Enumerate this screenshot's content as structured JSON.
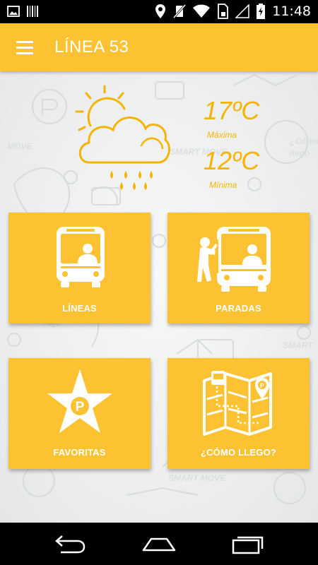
{
  "status_bar": {
    "time": "11:48",
    "icons": [
      "image-icon",
      "barcode-icon",
      "location-icon",
      "vibrate-icon",
      "wifi-icon",
      "sim-icon",
      "signal-icon",
      "battery-icon"
    ]
  },
  "app_bar": {
    "title": "LÍNEA 53",
    "menu_icon": "hamburger-menu-icon",
    "color": "#fcc232"
  },
  "weather": {
    "icon": "partly-cloudy-rain-icon",
    "max_temp": "17ºC",
    "max_label": "Máxima",
    "min_temp": "12ºC",
    "min_label": "Mínima",
    "color": "#f5b400"
  },
  "tiles": [
    {
      "label": "LÍNEAS",
      "icon": "bus-front-icon"
    },
    {
      "label": "PARADAS",
      "icon": "bus-stop-icon"
    },
    {
      "label": "FAVORITAS",
      "icon": "star-parking-icon"
    },
    {
      "label": "¿CÓMO LLEGO?",
      "icon": "route-map-icon"
    }
  ],
  "nav_bar": {
    "buttons": [
      "back-icon",
      "home-icon",
      "recents-icon"
    ]
  }
}
